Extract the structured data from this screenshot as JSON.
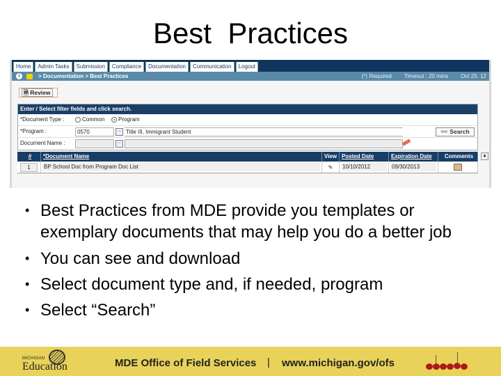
{
  "slide": {
    "title": "Best  Practices",
    "bullets": [
      "Best Practices from MDE provide you templates or exemplary documents that may help you do a better job",
      "You can see and download",
      "Select document type and, if needed, program",
      "Select “Search”"
    ]
  },
  "app": {
    "nav_tabs": [
      "Home",
      "Admin Tasks",
      "Submission",
      "Compliance",
      "Documentation",
      "Communication",
      "Logout"
    ],
    "breadcrumb": "> Documentation > Best Practices",
    "required_note": "(*)   Required",
    "timeout": "Timeout : 20 mins",
    "date": "Oct 25, 12",
    "review_button": "Review",
    "filter": {
      "header": "Enter / Select filter fields and click search.",
      "document_type_label": "*Document Type :",
      "radio_common": "Common",
      "radio_program": "Program",
      "selected_type": "Program",
      "program_label": "*Program :",
      "program_code": "0570",
      "program_name": "Title III, Immigrant Student",
      "document_name_label": "Document Name :",
      "document_name_value": "",
      "search_button": "Search"
    },
    "grid": {
      "columns": [
        "#",
        "*Document Name",
        "View",
        "Posted Date",
        "Expiration Date",
        "Comments"
      ],
      "rows": [
        {
          "num": "1",
          "document_name": "BP School Doc from Program Doc List",
          "posted_date": "10/10/2012",
          "expiration_date": "09/30/2013"
        }
      ]
    }
  },
  "footer": {
    "logo_small": "MICHIGAN",
    "logo_big": "Education",
    "office": "MDE Office of Field Services",
    "separator": "|",
    "url": "www.michigan.gov/ofs"
  },
  "colors": {
    "nav_dark": "#10365f",
    "breadcrumb_bar": "#5a8aa8",
    "footer_bg": "#e8d25a"
  }
}
